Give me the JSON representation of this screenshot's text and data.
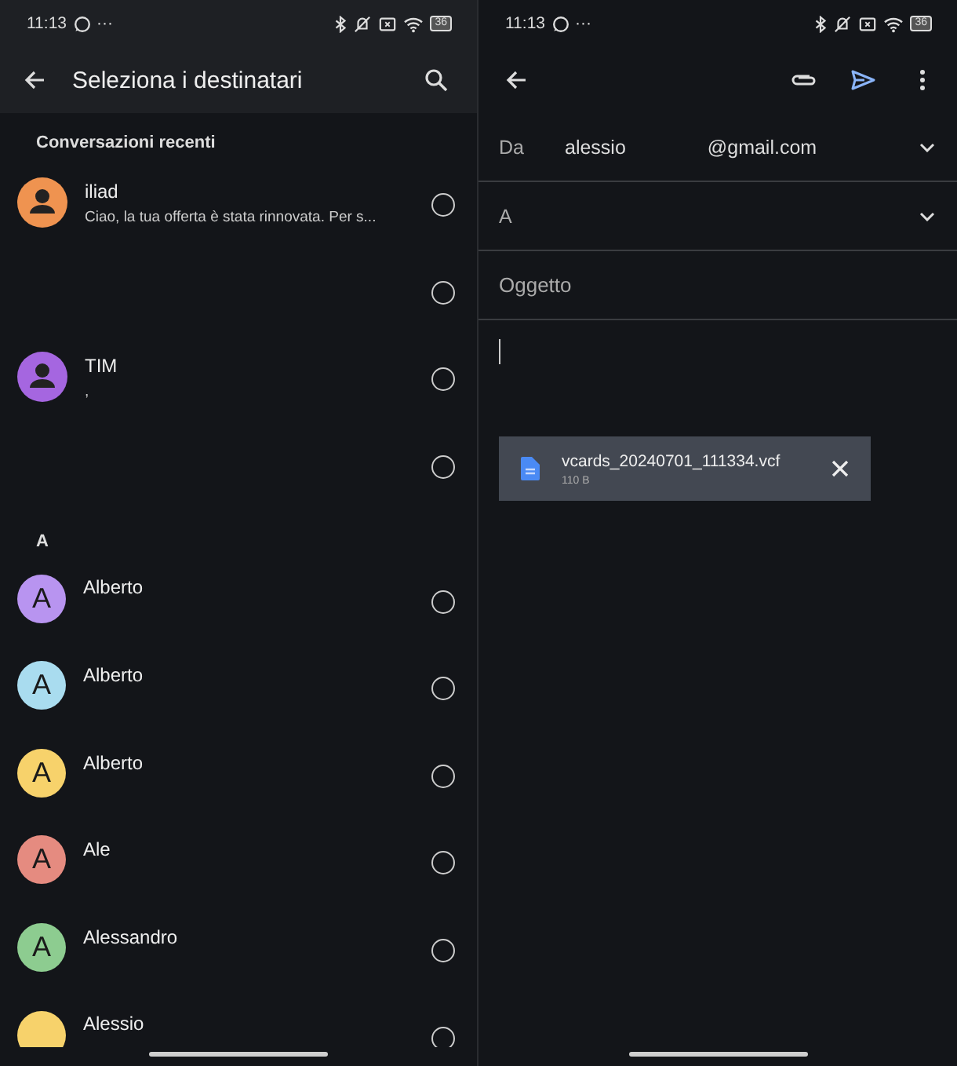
{
  "left": {
    "status_bar": {
      "time": "11:13",
      "dots": "···",
      "battery": "36"
    },
    "header": {
      "title": "Seleziona i destinatari"
    },
    "sections": [
      {
        "title": "Conversazioni recenti",
        "rows": [
          {
            "kind": "person",
            "name": "iliad",
            "preview": "Ciao, la tua offerta è stata rinnovata. Per s...",
            "color": "#ef9350",
            "selected": false
          },
          {
            "kind": "hidden",
            "selected": false
          },
          {
            "kind": "person",
            "name": "TIM",
            "preview": ",",
            "color": "#a566e0",
            "selected": false
          },
          {
            "kind": "hidden",
            "selected": false
          }
        ]
      },
      {
        "title": "A",
        "rows": [
          {
            "kind": "letter",
            "initial": "A",
            "name": "Alberto",
            "color": "#b894f0",
            "selected": false
          },
          {
            "kind": "letter",
            "initial": "A",
            "name": "Alberto",
            "color": "#a9dcef",
            "selected": false
          },
          {
            "kind": "letter",
            "initial": "A",
            "name": "Alberto",
            "color": "#f7d26b",
            "selected": false
          },
          {
            "kind": "letter",
            "initial": "A",
            "name": "Ale",
            "color": "#e58b80",
            "selected": false
          },
          {
            "kind": "letter",
            "initial": "A",
            "name": "Alessandro",
            "color": "#8dcc90",
            "selected": false
          },
          {
            "kind": "letter",
            "name": "Alessio",
            "color": "#f7d26b",
            "selected": false
          }
        ]
      }
    ]
  },
  "right": {
    "status_bar": {
      "time": "11:13",
      "dots": "···",
      "battery": "36"
    },
    "fields": [
      {
        "kind": "from",
        "label": "Da",
        "value": "alessio",
        "domain": "@gmail.com"
      },
      {
        "kind": "to",
        "label": "A"
      },
      {
        "kind": "subject",
        "placeholder": "Oggetto"
      }
    ],
    "attachment": {
      "name": "vcards_20240701_111334.vcf",
      "size": "110 B"
    }
  }
}
